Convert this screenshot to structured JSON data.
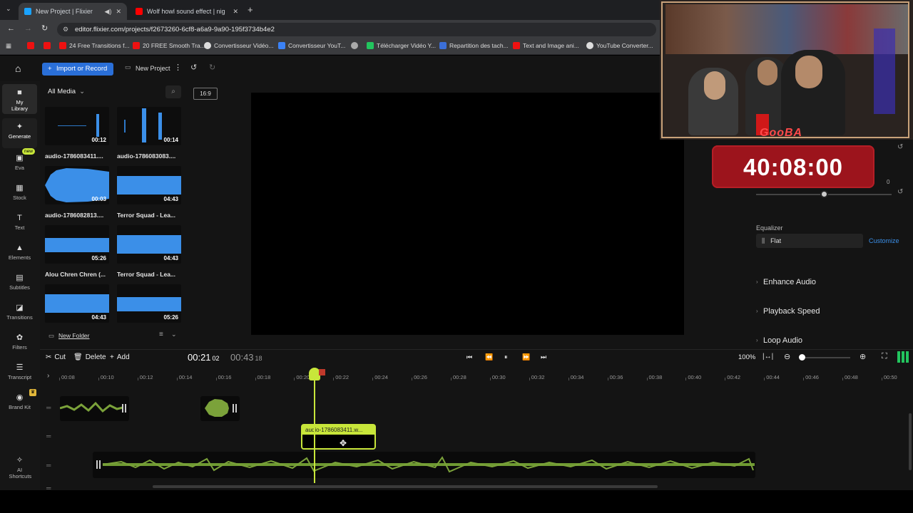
{
  "browser": {
    "tabs": [
      {
        "title": "New Project | Flixier",
        "active": true
      },
      {
        "title": "Wolf howl sound effect | night",
        "active": false
      }
    ],
    "url": "editor.flixier.com/projects/f2673260-6cf8-a6a9-9a90-195f3734b4e2",
    "bookmarks": [
      "24 Free Transitions f...",
      "20 FREE Smooth Tra...",
      "Convertisseur Vidéo...",
      "Convertisseur YouT...",
      "Télécharger Vidéo Y...",
      "Repartition des tach...",
      "Text and Image ani...",
      "YouTube Converter..."
    ]
  },
  "toolbar": {
    "import_label": "Import or Record",
    "project_label": "New Project"
  },
  "sidebar": {
    "items": [
      {
        "label": "My Library",
        "icon": "folder-icon"
      },
      {
        "label": "Generate",
        "icon": "sparkle-icon"
      },
      {
        "label": "Eva",
        "icon": "eva-icon",
        "badge": "new"
      },
      {
        "label": "Stock",
        "icon": "grid-icon"
      },
      {
        "label": "Text",
        "icon": "text-icon"
      },
      {
        "label": "Elements",
        "icon": "shapes-icon"
      },
      {
        "label": "Subtitles",
        "icon": "subtitles-icon"
      },
      {
        "label": "Transitions",
        "icon": "transitions-icon"
      },
      {
        "label": "Filters",
        "icon": "filters-icon"
      },
      {
        "label": "Transcript",
        "icon": "transcript-icon"
      },
      {
        "label": "Brand Kit",
        "icon": "brandkit-icon"
      },
      {
        "label": "AI Shortcuts",
        "icon": "ai-icon"
      }
    ]
  },
  "library": {
    "filter": "All Media",
    "items": [
      {
        "name": "audio-1786083411....",
        "duration": "00:12"
      },
      {
        "name": "audio-1786083083....",
        "duration": "00:14"
      },
      {
        "name": "audio-1786082813....",
        "duration": "00:03"
      },
      {
        "name": "Terror Squad - Lea...",
        "duration": "04:43"
      },
      {
        "name": "Alou Chren Chren (...",
        "duration": "05:26"
      },
      {
        "name": "Terror Squad - Lea...",
        "duration": "04:43"
      },
      {
        "name": "",
        "duration": "04:43"
      },
      {
        "name": "",
        "duration": "05:26"
      }
    ],
    "new_folder": "New Folder"
  },
  "preview": {
    "aspect_ratio": "16:9"
  },
  "right_panel": {
    "equalizer_label": "Equalizer",
    "equalizer_value": "Flat",
    "customize_label": "Customize",
    "volume_value": "0",
    "sections": [
      "Enhance Audio",
      "Playback Speed",
      "Loop Audio"
    ]
  },
  "overlay": {
    "streamer_name": "GooBA",
    "timer": "40:08:00"
  },
  "timeline": {
    "cut_label": "Cut",
    "delete_label": "Delete",
    "add_label": "Add",
    "current_time": "00:21",
    "current_frame": "02",
    "total_time": "00:43",
    "total_frame": "18",
    "zoom": "100%",
    "ticks": [
      "00:08",
      "00:10",
      "00:12",
      "00:14",
      "00:16",
      "00:18",
      "00:20",
      "00:22",
      "00:24",
      "00:26",
      "00:28",
      "00:30",
      "00:32",
      "00:34",
      "00:36",
      "00:38",
      "00:40",
      "00:42",
      "00:44",
      "00:46",
      "00:48",
      "00:50"
    ],
    "selected_clip_name": "audio-1786083411.w...",
    "accent_color": "#c8e63a"
  }
}
